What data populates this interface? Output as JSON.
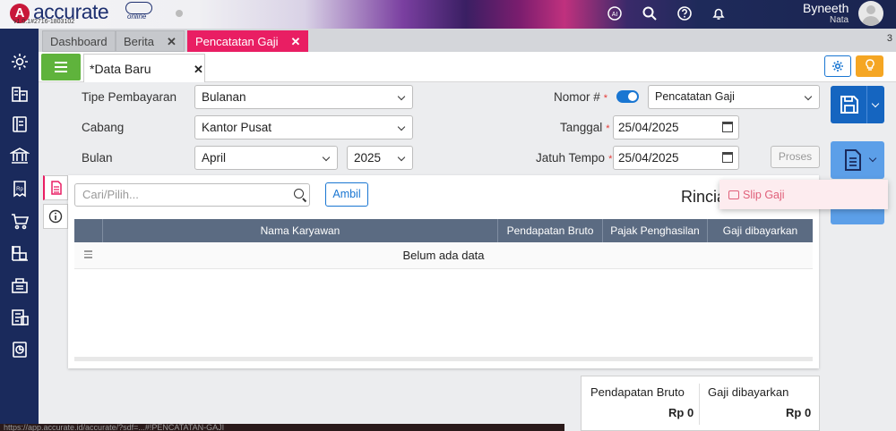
{
  "header": {
    "logo_letter": "A",
    "logo_text": "accurate",
    "logo_sub": "online",
    "version": "v1.0.1#2716-1803102",
    "user_name": "Byneeth",
    "user_sub": "Nata",
    "icons": [
      "ai-icon",
      "search-icon",
      "help-icon",
      "bell-icon"
    ]
  },
  "tabs": {
    "items": [
      {
        "label": "Dashboard",
        "active": false,
        "closable": false
      },
      {
        "label": "Berita",
        "active": false,
        "closable": true
      },
      {
        "label": "Pencatatan Gaji",
        "active": true,
        "closable": true
      }
    ],
    "close_glyph": "✕",
    "count": "3"
  },
  "subtab": {
    "label": "*Data Baru",
    "close_glyph": "✕"
  },
  "form": {
    "tipe_pembayaran": {
      "label": "Tipe Pembayaran",
      "value": "Bulanan"
    },
    "cabang": {
      "label": "Cabang",
      "value": "Kantor Pusat"
    },
    "bulan": {
      "label": "Bulan",
      "month": "April",
      "year": "2025"
    },
    "nomor": {
      "label": "Nomor #",
      "value": "Pencatatan Gaji",
      "required": "*"
    },
    "tanggal": {
      "label": "Tanggal",
      "value": "25/04/2025",
      "required": "*"
    },
    "jatuh_tempo": {
      "label": "Jatuh Tempo",
      "value": "25/04/2025",
      "required": "*"
    },
    "proses_label": "Proses"
  },
  "detail": {
    "search_placeholder": "Cari/Pilih...",
    "ambil_label": "Ambil",
    "rincian_title": "Rincia",
    "columns": [
      "Nama Karyawan",
      "Pendapatan Bruto",
      "Pajak Penghasilan",
      "Gaji dibayarkan"
    ],
    "empty_text": "Belum ada data"
  },
  "menu": {
    "slip_gaji": "Slip Gaji"
  },
  "totals": {
    "pendapatan_bruto_label": "Pendapatan Bruto",
    "pendapatan_bruto_value": "Rp 0",
    "gaji_dibayarkan_label": "Gaji dibayarkan",
    "gaji_dibayarkan_value": "Rp 0"
  },
  "status_url": "https://app.accurate.id/accurate/?sdf=...#!PENCATATAN-GAJI",
  "colors": {
    "accent": "#e91e63",
    "nav": "#1a2a5c",
    "primary": "#1565c0",
    "green": "#5fb33c",
    "orange": "#f5a623"
  }
}
